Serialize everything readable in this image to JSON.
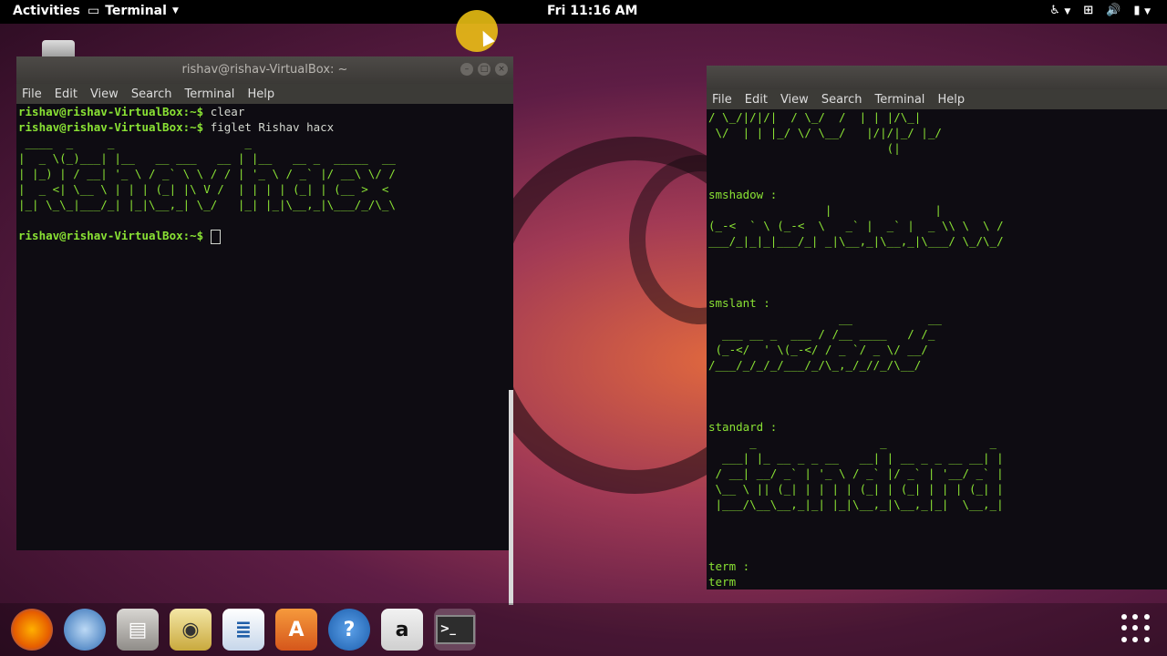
{
  "topbar": {
    "activities": "Activities",
    "app_menu": "Terminal",
    "clock": "Fri 11:16 AM",
    "tray_icons": [
      "accessibility-icon",
      "network-icon",
      "volume-icon",
      "battery-icon"
    ]
  },
  "menu_items": [
    "File",
    "Edit",
    "View",
    "Search",
    "Terminal",
    "Help"
  ],
  "left_terminal": {
    "title": "rishav@rishav-VirtualBox: ~",
    "lines": [
      {
        "prompt": "rishav@rishav-VirtualBox:~$",
        "cmd": " clear"
      },
      {
        "prompt": "rishav@rishav-VirtualBox:~$",
        "cmd": " figlet Rishav hacx"
      }
    ],
    "figlet": " ____  _     _                   _                      \n|  _ \\(_)___| |__   __ ___   __ | |__   __ _  _____  __\n| |_) | / __| '_ \\ / _` \\ \\ / / | '_ \\ / _` |/ __\\ \\/ /\n|  _ <| \\__ \\ | | | (_| |\\ V /  | | | | (_| | (__ >  < \n|_| \\_\\_|___/_| |_|\\__,_| \\_/   |_| |_|\\__,_|\\___/_/\\_\\",
    "final_prompt": "rishav@rishav-VirtualBox:~$"
  },
  "right_terminal": {
    "content": "/ \\_/|/|/|  / \\_/  /  | | |/\\_|\n \\/  | | |_/ \\/ \\__/   |/|/|_/ |_/\n                          (|\n\n\nsmshadow :\n                 |               |\n(_-<  ` \\ (_-<  \\   _` |  _` |  _ \\\\ \\  \\ /\n___/_|_|_|___/_| _|\\__,_|\\__,_|\\___/ \\_/\\_/\n\n\n\nsmslant :\n                   __           __\n  ___ __ _  ___ / /__ ____   / /_\n (_-</  ' \\(_-</ / _ `/ _ \\/ __/\n/___/_/_/_/___/_/\\_,_/_//_/\\__/\n\n\n\nstandard :\n      _                  _               _\n  ___| |_ __ _ _ __   __| | __ _ _ __ __| |\n / __| __/ _` | '_ \\ / _` |/ _` | '__/ _` |\n \\__ \\ || (_| | | | | (_| | (_| | | | (_| |\n |___/\\__\\__,_|_| |_|\\__,_|\\__,_|_|  \\__,_|\n\n\n\nterm :\nterm"
  },
  "dock": [
    "firefox-icon",
    "thunderbird-icon",
    "files-icon",
    "rhythmbox-icon",
    "writer-icon",
    "software-icon",
    "help-icon",
    "amazon-icon",
    "terminal-icon"
  ]
}
